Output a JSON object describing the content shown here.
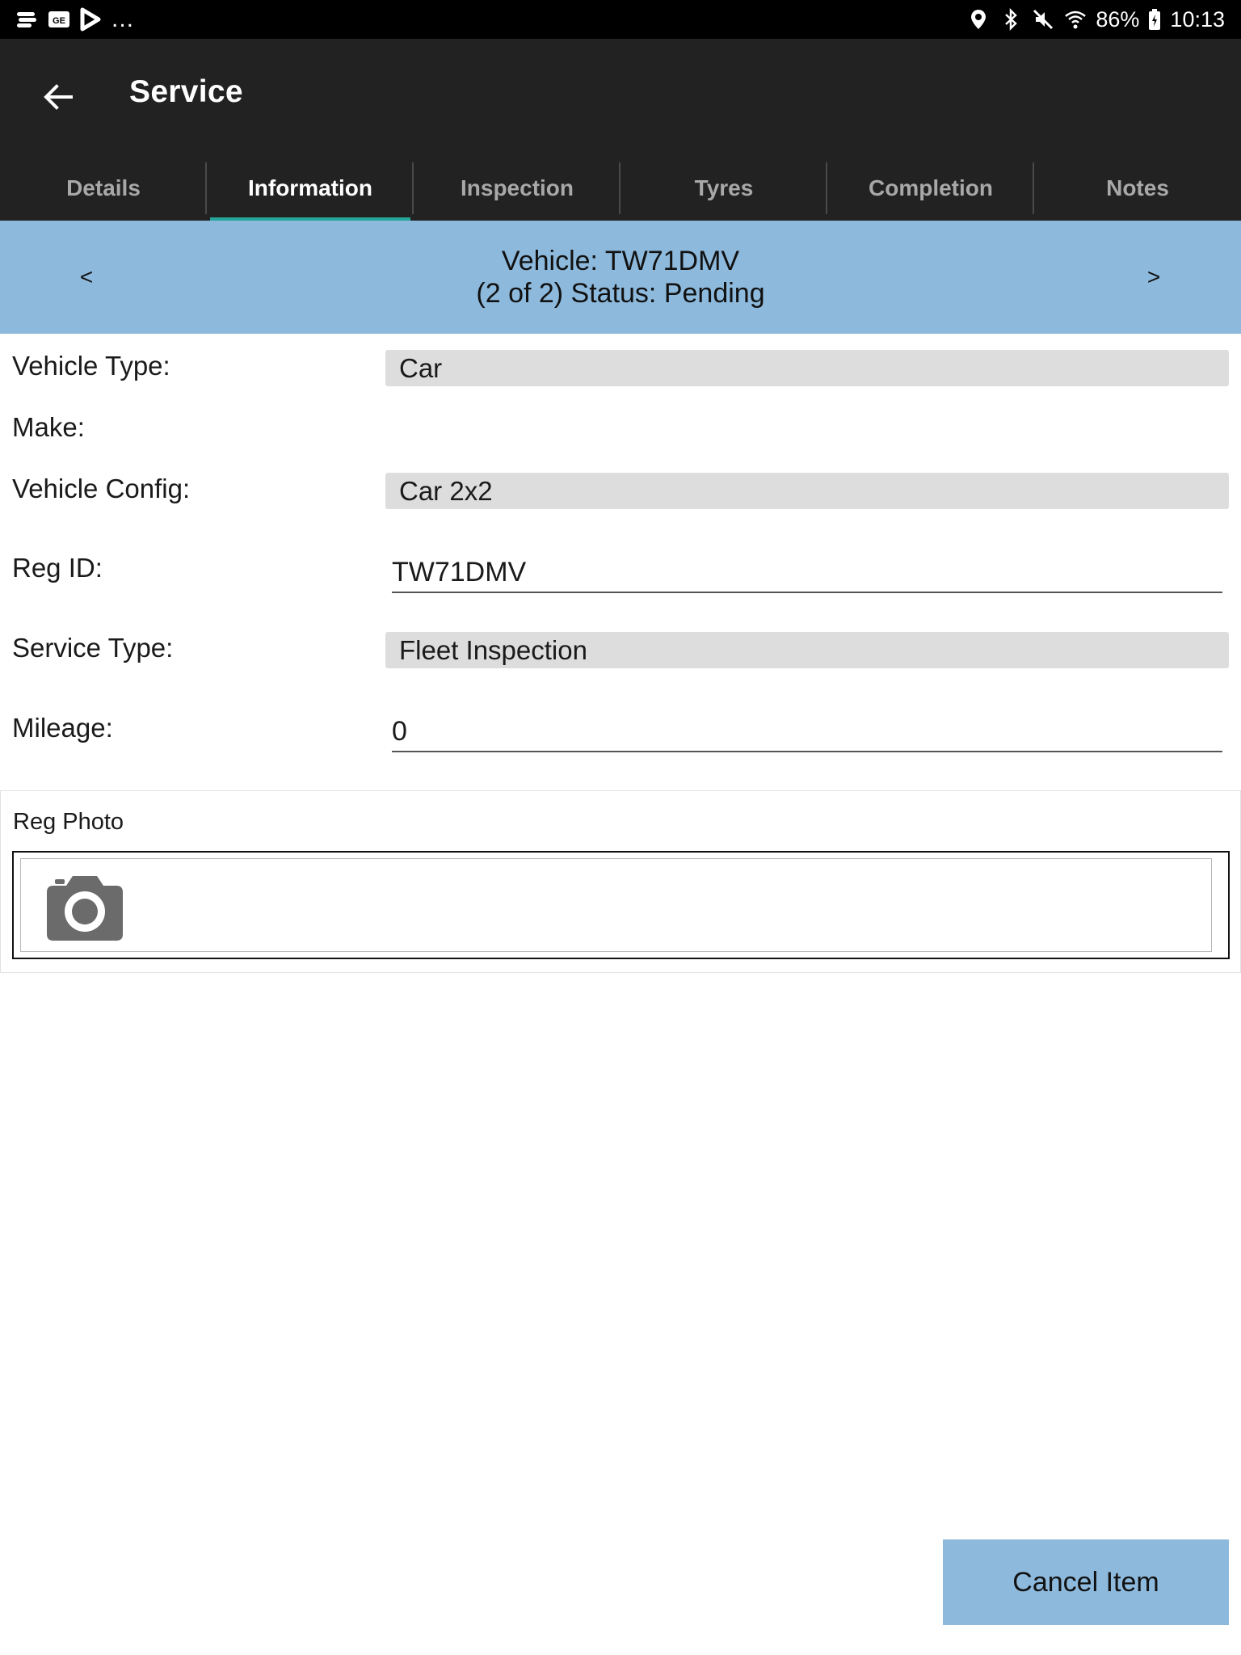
{
  "status_bar": {
    "left_icons": [
      "notification-icon-1",
      "notification-icon-2",
      "play-icon"
    ],
    "more": "...",
    "right_icons": [
      "location-icon",
      "bluetooth-icon",
      "mute-icon",
      "wifi-icon"
    ],
    "battery": "86%",
    "time": "10:13"
  },
  "app_bar": {
    "title": "Service",
    "back_icon": "arrow-left-icon"
  },
  "tabs": [
    {
      "label": "Details",
      "active": false
    },
    {
      "label": "Information",
      "active": true
    },
    {
      "label": "Inspection",
      "active": false
    },
    {
      "label": "Tyres",
      "active": false
    },
    {
      "label": "Completion",
      "active": false
    },
    {
      "label": "Notes",
      "active": false
    }
  ],
  "vehicle_nav": {
    "prev": "<",
    "next": ">",
    "line1": "Vehicle: TW71DMV",
    "line2": "(2 of 2) Status: Pending"
  },
  "form": {
    "vehicle_type": {
      "label": "Vehicle Type:",
      "value": "Car"
    },
    "make": {
      "label": "Make:",
      "value": ""
    },
    "vehicle_config": {
      "label": "Vehicle Config:",
      "value": "Car 2x2"
    },
    "reg_id": {
      "label": "Reg ID:",
      "value": "TW71DMV"
    },
    "service_type": {
      "label": "Service Type:",
      "value": "Fleet Inspection"
    },
    "mileage": {
      "label": "Mileage:",
      "value": "0"
    }
  },
  "reg_photo": {
    "label": "Reg Photo",
    "icon": "camera-icon"
  },
  "actions": {
    "cancel_label": "Cancel Item"
  },
  "colors": {
    "app_bar_bg": "#222222",
    "tab_indicator": "#26a69a",
    "accent_blue": "#8db9dc",
    "field_bg": "#dddddd"
  }
}
